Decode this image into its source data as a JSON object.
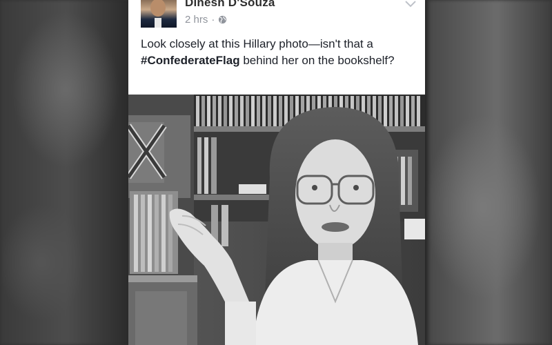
{
  "post": {
    "author": "Dinesh D'Souza",
    "timestamp": "2 hrs",
    "separator": "·",
    "text_lead": "Look closely at this Hillary photo—isn't that a",
    "hashtag": "#ConfederateFlag",
    "text_tail": "behind her on the bookshelf?"
  },
  "icons": {
    "avatar": "profile-photo",
    "audience": "globe-icon",
    "menu": "chevron-down-icon"
  },
  "photo": {
    "subject": "black-and-white photo"
  },
  "colors": {
    "author": "#2d2d2d",
    "meta": "#90949c",
    "text": "#1d2129"
  }
}
